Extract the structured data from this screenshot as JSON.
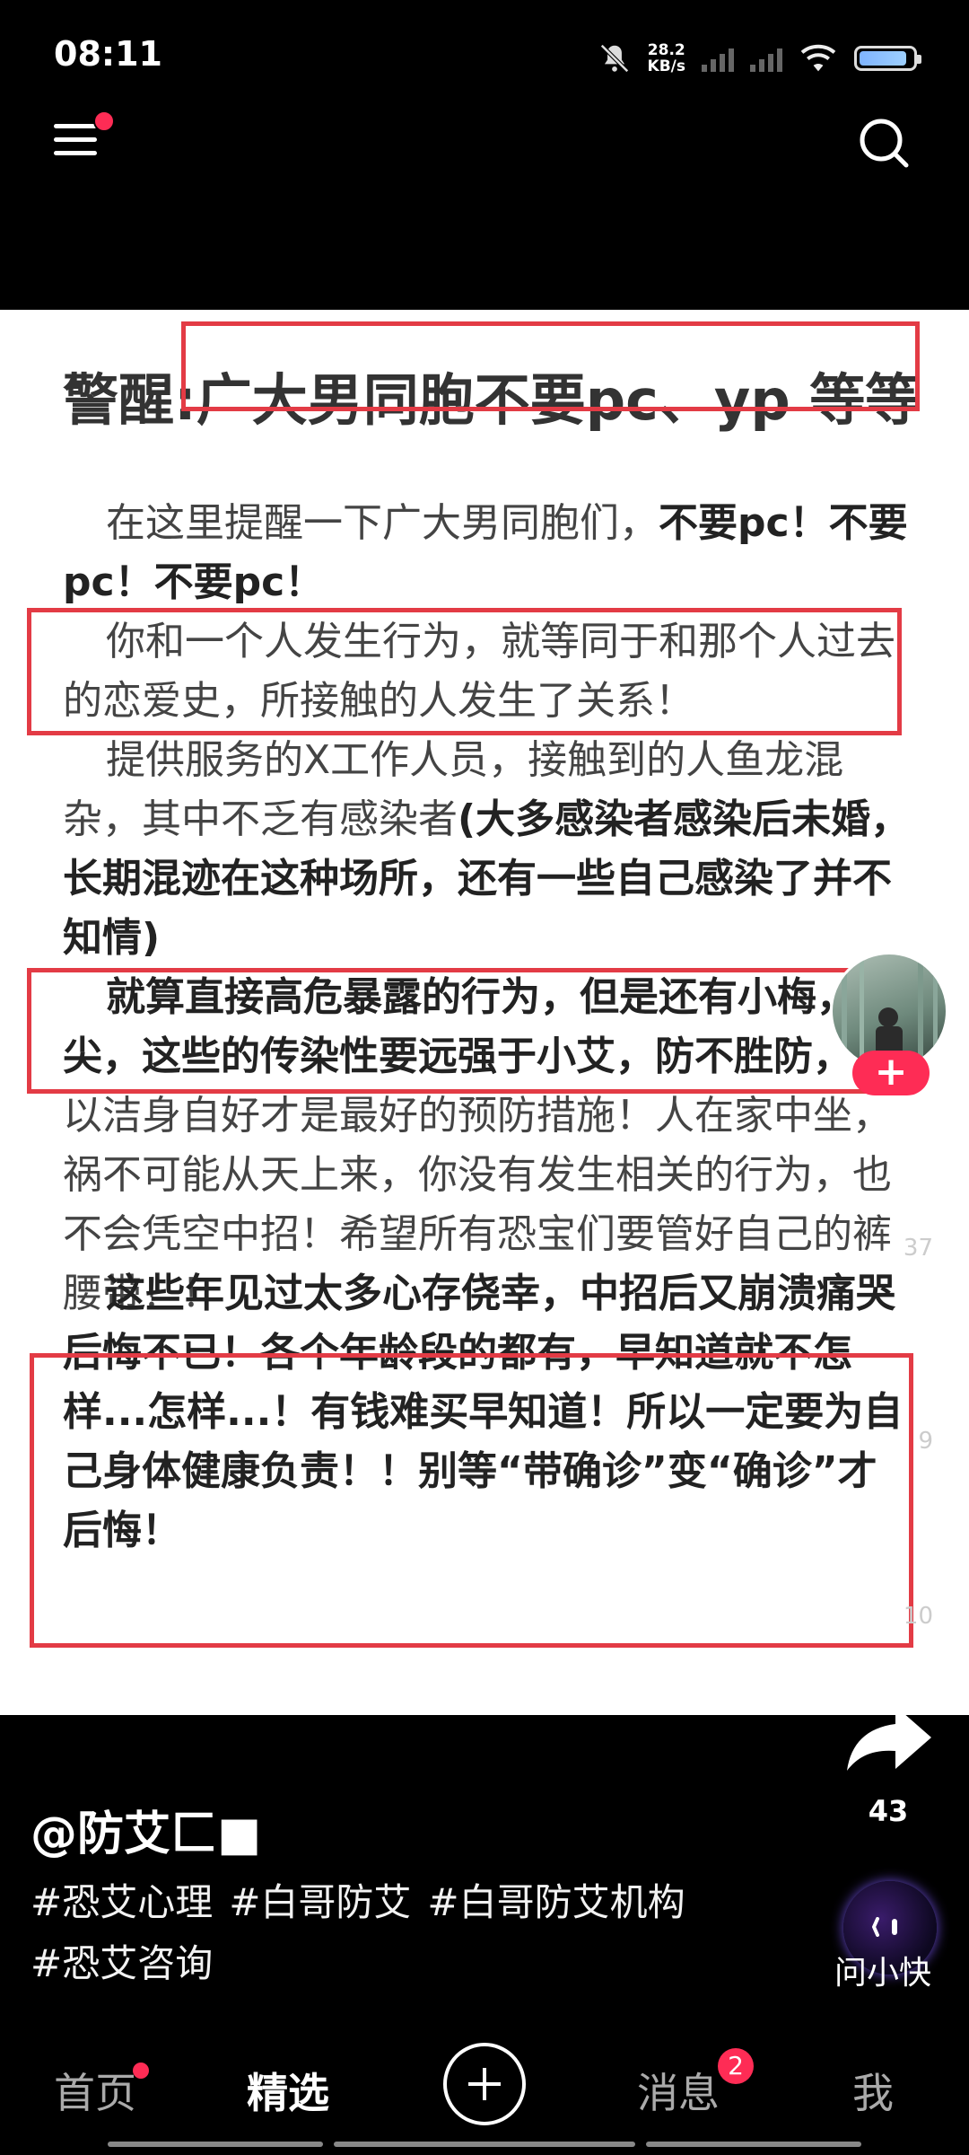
{
  "status_bar": {
    "time": "08:11",
    "net_speed": "28.2",
    "net_unit": "KB/s",
    "battery_level": 0.9
  },
  "top_nav": {
    "menu_icon": "hamburger-menu-icon",
    "search_icon": "search-icon"
  },
  "post": {
    "title": "警醒:广大男同胞不要pc、yp 等等",
    "p1_normal": "在这里提醒一下广大男同胞们，",
    "p1_bold": "不要pc！不要pc！不要pc！",
    "p2": "你和一个人发生行为，就等同于和那个人过去的恋爱史，所接触的人发生了关系！",
    "p3_normal": "提供服务的X工作人员，接触到的人鱼龙混杂，其中不乏有感染者",
    "p3_bold": "(大多感染者感染后未婚，长期混迹在这种场所，还有一些自己感染了并不知情)",
    "p4_bold": "就算直接高危暴露的行为，但是还有小梅，小尖，这些的传染性要远强于小艾，防不胜防，",
    "p4_normal": "所以洁身自好才是最好的预防措施！人在家中坐，祸不可能从天上来，你没有发生相关的行为，也不会凭空中招！希望所有恐宝们要管好自己的裤腰带！！",
    "p5_bold": "这些年见过太多心存侥幸，中招后又崩溃痛哭后悔不已！各个年龄段的都有，早知道就不怎样...怎样...！有钱难买早知道！所以一定要为自己身体健康负责！！别等“带确诊”变“确诊”才后悔！",
    "ghost_counts": [
      "37",
      "9",
      "10"
    ]
  },
  "side": {
    "follow_label": "+",
    "share_count": "43",
    "assistant_label": "问小快"
  },
  "author": {
    "username": "@防艾匚■"
  },
  "hashtags": [
    "#恐艾心理",
    "#白哥防艾",
    "#白哥防艾机构",
    "#恐艾咨询"
  ],
  "tabbar": {
    "home": "首页",
    "featured": "精选",
    "messages": "消息",
    "messages_badge": "2",
    "me": "我"
  }
}
